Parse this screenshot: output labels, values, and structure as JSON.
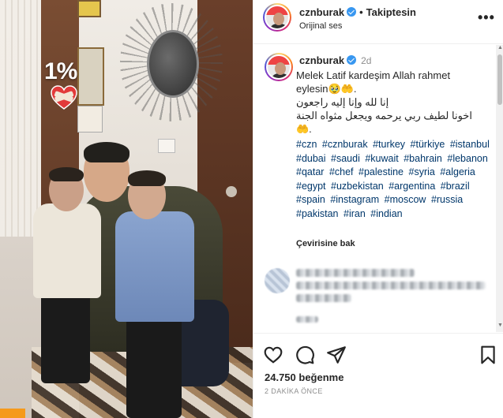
{
  "media": {
    "sticker_percent": "1%",
    "sticker_heart_icon": "heart-bandage-icon"
  },
  "header": {
    "username": "cznburak",
    "separator": "•",
    "follow_label": "Takiptesin",
    "audio_label": "Orijinal ses",
    "more_icon": "more-horizontal-icon"
  },
  "caption": {
    "username": "cznburak",
    "time_ago": "2d",
    "line1": "Melek Latif kardeşim Allah rahmet",
    "line2": "eylesin🥹🤲.",
    "line3": "إنا لله وإنا إليه راجعون",
    "line4": "اخونا لطيف ربي يرحمه ويجعل مثواه الجنة",
    "line5": "🤲."
  },
  "hashtags": [
    "#czn",
    "#cznburak",
    "#turkey",
    "#türkiye",
    "#istanbul",
    "#dubai",
    "#saudi",
    "#kuwait",
    "#bahrain",
    "#lebanon",
    "#qatar",
    "#chef",
    "#palestine",
    "#syria",
    "#algeria",
    "#egypt",
    "#uzbekistan",
    "#argentina",
    "#brazil",
    "#spain",
    "#instagram",
    "#moscow",
    "#russia",
    "#pakistan",
    "#iran",
    "#indian"
  ],
  "translate_label": "Çevirisine bak",
  "actions": {
    "like_icon": "heart-outline-icon",
    "comment_icon": "comment-bubble-icon",
    "share_icon": "paper-plane-icon",
    "save_icon": "bookmark-icon"
  },
  "likes": "24.750 beğenme",
  "timestamp": "2 DAKİKA ÖNCE",
  "colors": {
    "hashtag": "#00376b",
    "verified": "#3897f0",
    "muted": "#8e8e8e",
    "text": "#262626"
  }
}
